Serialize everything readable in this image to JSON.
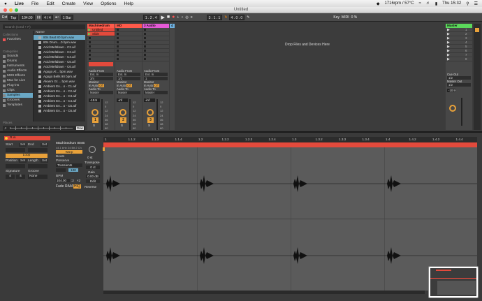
{
  "menubar": {
    "apple": "",
    "items": [
      "Live",
      "File",
      "Edit",
      "Create",
      "View",
      "Options",
      "Help"
    ],
    "status": "1716rpm / 57°C",
    "clock": "Thu 15:32"
  },
  "window": {
    "title": "Untitled"
  },
  "transport": {
    "ext": "Ext",
    "tap": "Tap",
    "tempo": "104.00",
    "signature": "4 / 4",
    "quant": "1 Bar",
    "position": "1 . 2 . 4",
    "loop_start": "3 . 1 . 1",
    "loop_len": "4 . 0 . 0",
    "key": "Key",
    "midi": "MIDI",
    "cpu": "0 %"
  },
  "browser": {
    "search": "Search (Cmd + F)",
    "collections_h": "Collections",
    "favorites": "Favorites",
    "categories_h": "Categories",
    "categories": [
      "Sounds",
      "Drums",
      "Instruments",
      "Audio Effects",
      "MIDI Effects",
      "Max for Live",
      "Plug-ins",
      "Clips",
      "Samples",
      "Grooves",
      "Templates"
    ],
    "places_h": "Places",
    "name_h": "Name",
    "files": [
      "80s Beat 80 bpm.wav",
      "80s Drum....0 bpm.wav",
      "Acid Meltdown - C2.aif",
      "Acid Meltdown - C3.aif",
      "Acid Meltdown - C4.aif",
      "Acid Meltdown - C5.aif",
      "Acid Meltdown - C6.aif",
      "Agogo Al... bpm.wav",
      "Agogo Bells 90 bpm.aif",
      "Akasm Gr.... bpm.wav",
      "Ambient En....s - C1.aif",
      "Ambient En....s - C2.aif",
      "Ambient En....s - C3.aif",
      "Ambient En....s - C4.aif",
      "Ambient En....s - C5.aif",
      "Ambient En....s - C6.aif"
    ],
    "preview_raw": "Raw"
  },
  "tracks": [
    {
      "name": "Machinedrum",
      "color": "#ff5a4a",
      "clip1": "Untitled",
      "clip2": "Slide",
      "num": "1",
      "vol": "-10.9"
    },
    {
      "name": "MD",
      "color": "#ff5a4a",
      "num": "2",
      "vol": "-inf"
    },
    {
      "name": "3 Audio",
      "color": "#e55ad6",
      "num": "3",
      "vol": "-inf"
    },
    {
      "name": "4",
      "color": "#6fb1e0"
    }
  ],
  "mixer": {
    "audio_from": "Audio From",
    "ext_in": "Ext. In",
    "ch12": "1/2",
    "ch34": "3/4",
    "ch1": "1",
    "monitor": "Monitor",
    "in": "In",
    "auto": "Auto",
    "off": "Off",
    "audio_to": "Audio To",
    "master": "Master",
    "scale": [
      "12",
      "0",
      "12",
      "24",
      "36",
      "48",
      "60"
    ],
    "s": "S",
    "c": "C"
  },
  "master": {
    "name": "Master",
    "cue_out": "Cue Out",
    "cue_val": "1/2",
    "master_out": "Master Out",
    "master_val": "1/2",
    "vol": "-10.9",
    "drop": "Drop Files and Devices Here"
  },
  "clip": {
    "name": "R.in",
    "start": "Start",
    "end": "End",
    "set": "Set",
    "loop": "Loop",
    "position": "Position",
    "length": "Length",
    "signature": "Signature",
    "groove": "Groove",
    "sig_a": "4",
    "sig_b": "4",
    "groove_val": "None",
    "sample": "Machinedrum 0046",
    "sample_info": "44.1 kHz 24 Bit 2 Ch",
    "warp": "Warp",
    "beats": "Beats",
    "preserve": "Preserve",
    "transients": "Transients",
    "bpm": "BPM",
    "bpm_val": "104.00",
    "half": ":2",
    "dbl": "×2",
    "fade": "Fade",
    "ram": "RAM",
    "hiq": "HiQ",
    "transpose": "Transpose",
    "transpose_val": "0 st",
    "detune": "0 ct",
    "gain": "Gain",
    "gain_val": "0.00 dB",
    "edit": "Edit",
    "reverse": "Reverse",
    "pitch_knob": "0 st"
  },
  "ruler": [
    "1",
    "1.1.2",
    "1.1.3",
    "1.1.4",
    "1.2",
    "1.2.2",
    "1.2.3",
    "1.2.4",
    "1.3",
    "1.3.2",
    "1.3.3",
    "1.3.4",
    "1.4",
    "1.4.2",
    "1.4.3",
    "1.4.4"
  ]
}
